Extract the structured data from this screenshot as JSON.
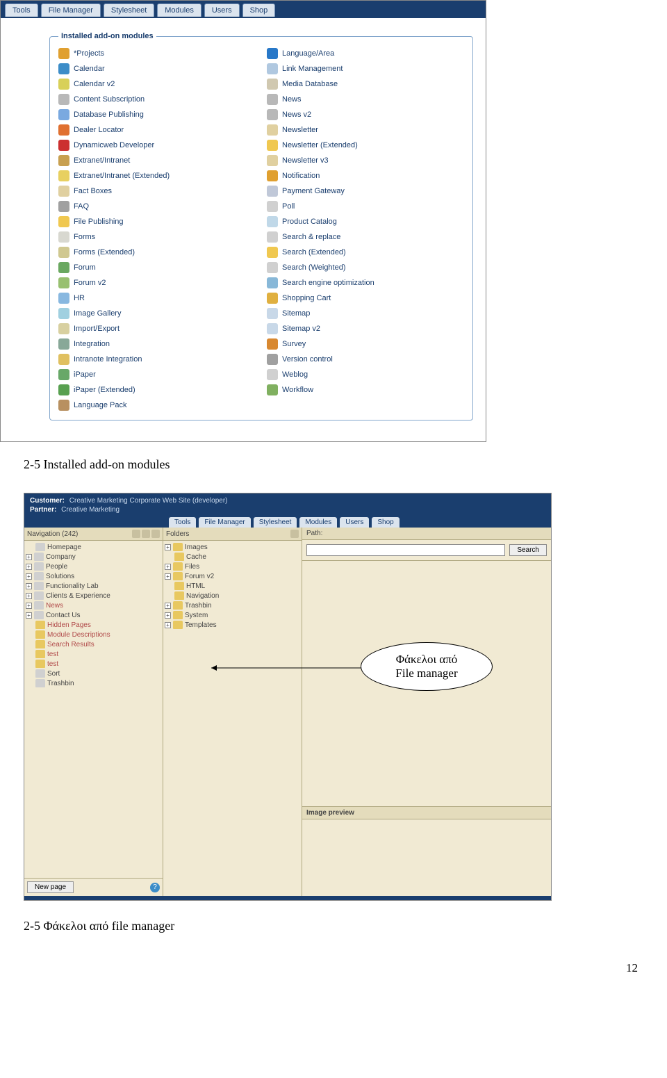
{
  "menubar": [
    "Tools",
    "File Manager",
    "Stylesheet",
    "Modules",
    "Users",
    "Shop"
  ],
  "modules_legend": "Installed add-on modules",
  "modules_left": [
    {
      "label": "*Projects",
      "ic": "ic-a"
    },
    {
      "label": "Calendar",
      "ic": "ic-b"
    },
    {
      "label": "Calendar v2",
      "ic": "ic-c"
    },
    {
      "label": "Content Subscription",
      "ic": "ic-d"
    },
    {
      "label": "Database Publishing",
      "ic": "ic-e"
    },
    {
      "label": "Dealer Locator",
      "ic": "ic-f"
    },
    {
      "label": "Dynamicweb Developer",
      "ic": "ic-g"
    },
    {
      "label": "Extranet/Intranet",
      "ic": "ic-h"
    },
    {
      "label": "Extranet/Intranet (Extended)",
      "ic": "ic-i"
    },
    {
      "label": "Fact Boxes",
      "ic": "ic-j"
    },
    {
      "label": "FAQ",
      "ic": "ic-k"
    },
    {
      "label": "File Publishing",
      "ic": "ic-l"
    },
    {
      "label": "Forms",
      "ic": "ic-m"
    },
    {
      "label": "Forms (Extended)",
      "ic": "ic-n"
    },
    {
      "label": "Forum",
      "ic": "ic-o"
    },
    {
      "label": "Forum v2",
      "ic": "ic-p"
    },
    {
      "label": "HR",
      "ic": "ic-q"
    },
    {
      "label": "Image Gallery",
      "ic": "ic-r"
    },
    {
      "label": "Import/Export",
      "ic": "ic-s"
    },
    {
      "label": "Integration",
      "ic": "ic-t"
    },
    {
      "label": "Intranote Integration",
      "ic": "ic-u"
    },
    {
      "label": "iPaper",
      "ic": "ic-v"
    },
    {
      "label": "iPaper (Extended)",
      "ic": "ic-w"
    },
    {
      "label": "Language Pack",
      "ic": "ic-x"
    }
  ],
  "modules_right": [
    {
      "label": "Language/Area",
      "ic": "ic-globe"
    },
    {
      "label": "Link Management",
      "ic": "ic-y"
    },
    {
      "label": "Media Database",
      "ic": "ic-z"
    },
    {
      "label": "News",
      "ic": "ic-d"
    },
    {
      "label": "News v2",
      "ic": "ic-d"
    },
    {
      "label": "Newsletter",
      "ic": "ic-j"
    },
    {
      "label": "Newsletter (Extended)",
      "ic": "ic-l"
    },
    {
      "label": "Newsletter v3",
      "ic": "ic-j"
    },
    {
      "label": "Notification",
      "ic": "ic-a"
    },
    {
      "label": "Payment Gateway",
      "ic": "ic-pay"
    },
    {
      "label": "Poll",
      "ic": "ic-poll"
    },
    {
      "label": "Product Catalog",
      "ic": "ic-prod"
    },
    {
      "label": "Search & replace",
      "ic": "ic-srch"
    },
    {
      "label": "Search (Extended)",
      "ic": "ic-l"
    },
    {
      "label": "Search (Weighted)",
      "ic": "ic-srch"
    },
    {
      "label": "Search engine optimization",
      "ic": "ic-seo"
    },
    {
      "label": "Shopping Cart",
      "ic": "ic-cart"
    },
    {
      "label": "Sitemap",
      "ic": "ic-site"
    },
    {
      "label": "Sitemap v2",
      "ic": "ic-site"
    },
    {
      "label": "Survey",
      "ic": "ic-surv"
    },
    {
      "label": "Version control",
      "ic": "ic-ver"
    },
    {
      "label": "Weblog",
      "ic": "ic-blog"
    },
    {
      "label": "Workflow",
      "ic": "ic-wf"
    }
  ],
  "caption1": "2-5 Installed add-on modules",
  "header2": {
    "customer_lbl": "Customer:",
    "customer_val": "Creative Marketing Corporate Web Site (developer)",
    "partner_lbl": "Partner:",
    "partner_val": "Creative Marketing"
  },
  "menubar2": [
    "Tools",
    "File Manager",
    "Stylesheet",
    "Modules",
    "Users",
    "Shop"
  ],
  "nav_title": "Navigation (242)",
  "nav_tree": [
    {
      "label": "Homepage",
      "exp": false,
      "page": true
    },
    {
      "label": "Company",
      "exp": true,
      "page": true
    },
    {
      "label": "People",
      "exp": true,
      "page": true
    },
    {
      "label": "Solutions",
      "exp": true,
      "page": true
    },
    {
      "label": "Functionality Lab",
      "exp": true,
      "page": true
    },
    {
      "label": "Clients & Experience",
      "exp": true,
      "page": true
    },
    {
      "label": "News",
      "exp": true,
      "page": true,
      "red": true
    },
    {
      "label": "Contact Us",
      "exp": true,
      "page": true
    },
    {
      "label": "Hidden Pages",
      "exp": false,
      "page": false,
      "red": true
    },
    {
      "label": "Module Descriptions",
      "exp": false,
      "page": false,
      "red": true
    },
    {
      "label": "Search Results",
      "exp": false,
      "page": false,
      "red": true
    },
    {
      "label": "test",
      "exp": false,
      "page": false,
      "red": true
    },
    {
      "label": "test",
      "exp": false,
      "page": false,
      "red": true
    },
    {
      "label": "Sort",
      "exp": false,
      "page": true,
      "icon": "gear"
    },
    {
      "label": "Trashbin",
      "exp": false,
      "page": true,
      "icon": "trash"
    }
  ],
  "new_page_btn": "New page",
  "folders_title": "Folders",
  "folders_tree": [
    {
      "label": "Images",
      "exp": true,
      "indent": 0
    },
    {
      "label": "Cache",
      "exp": false,
      "indent": 0
    },
    {
      "label": "Files",
      "exp": true,
      "indent": 0
    },
    {
      "label": "Forum v2",
      "exp": true,
      "indent": 0
    },
    {
      "label": "HTML",
      "exp": false,
      "indent": 0
    },
    {
      "label": "Navigation",
      "exp": false,
      "indent": 0
    },
    {
      "label": "Trashbin",
      "exp": true,
      "indent": 0
    },
    {
      "label": "System",
      "exp": true,
      "indent": 0
    },
    {
      "label": "Templates",
      "exp": true,
      "indent": 0
    }
  ],
  "path_label": "Path:",
  "search_btn": "Search",
  "preview_label": "Image preview",
  "callout_l1": "Φάκελοι από",
  "callout_l2": "File manager",
  "caption2": "2-5 Φάκελοι από file manager",
  "page_no": "12"
}
